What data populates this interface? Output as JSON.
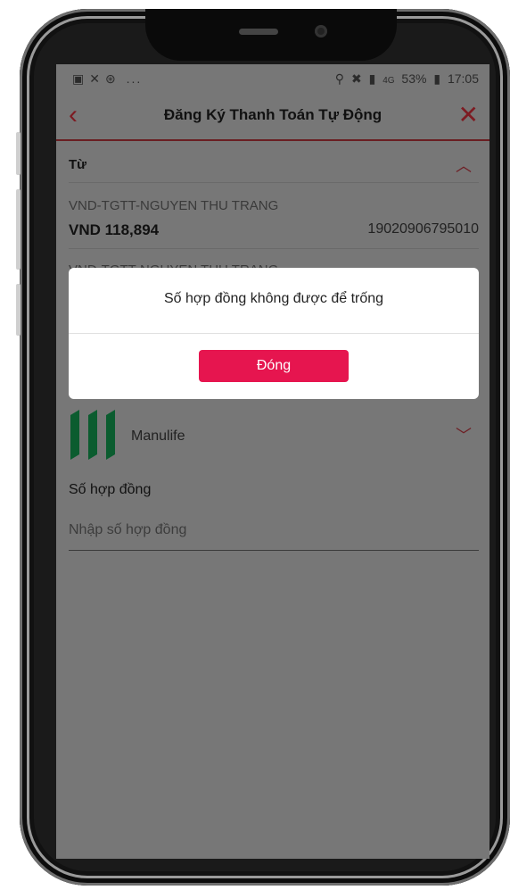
{
  "status_bar": {
    "left_icons": [
      "image-icon",
      "missed-call-icon",
      "messenger-icon"
    ],
    "left_more": "...",
    "network": "4G",
    "battery": "53%",
    "time": "17:05"
  },
  "header": {
    "title": "Đăng Ký Thanh Toán Tự Động",
    "back_icon": "chevron-left-icon",
    "close_icon": "close-icon"
  },
  "from_section": {
    "label": "Từ",
    "account_name": "VND-TGTT-NGUYEN THU TRANG",
    "balance": "VND 118,894",
    "account_number": "19020906795010",
    "second_account_name": "VND-TGTT-NGUYEN THU TRANG"
  },
  "provider": {
    "name": "Manulife"
  },
  "contract": {
    "label": "Số hợp đồng",
    "placeholder": "Nhập số hợp đồng",
    "value": ""
  },
  "modal": {
    "message": "Số hợp đồng không được để trống",
    "button_label": "Đóng"
  },
  "colors": {
    "accent": "#7d1b22",
    "button": "#e6154f",
    "overlay": "#777777"
  }
}
